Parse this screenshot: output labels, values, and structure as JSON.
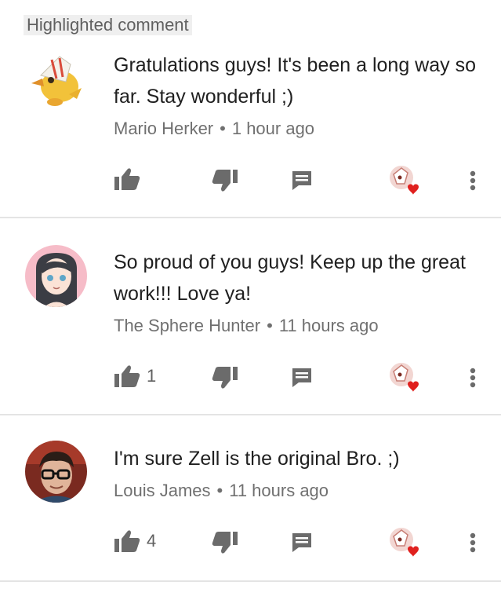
{
  "highlight_label": "Highlighted comment",
  "colors": {
    "heart": "#e0201e",
    "icon": "#6b6b6b",
    "text": "#202020",
    "meta": "#707070",
    "divider": "#e4e4e4"
  },
  "icons": [
    "like-icon",
    "dislike-icon",
    "reply-icon",
    "creator-heart-icon",
    "more-icon"
  ],
  "comments": [
    {
      "text": "Gratulations guys! It's been a long way so far. Stay wonderful ;)",
      "author": "Mario Herker",
      "separator": "•",
      "time": "1 hour ago",
      "likes": ""
    },
    {
      "text": "So proud of you guys! Keep up the great work!!! Love ya!",
      "author": "The Sphere Hunter",
      "separator": "•",
      "time": "11 hours ago",
      "likes": "1"
    },
    {
      "text": "I'm sure Zell is the original Bro. ;)",
      "author": "Louis James",
      "separator": "•",
      "time": "11 hours ago",
      "likes": "4"
    }
  ]
}
